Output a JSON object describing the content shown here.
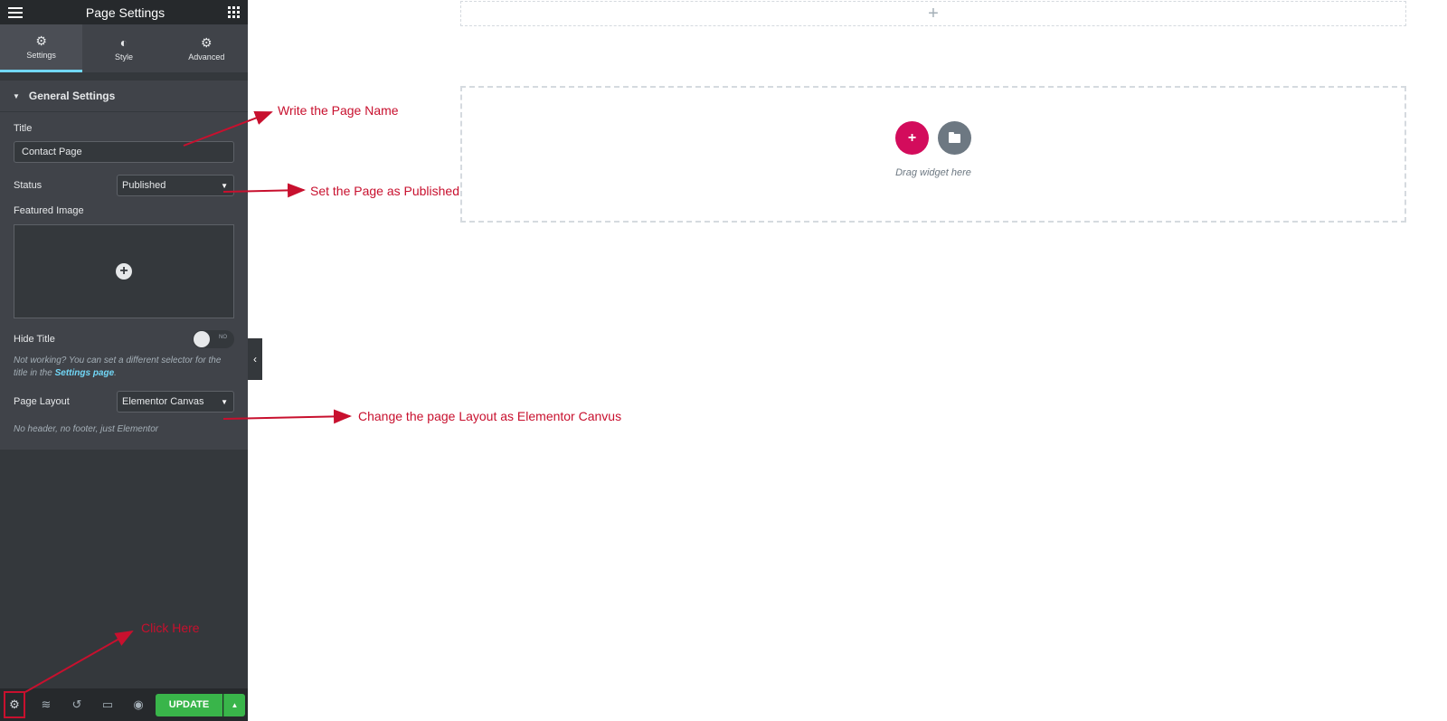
{
  "header": {
    "title": "Page Settings",
    "menu_icon": "hamburger-icon",
    "apps_icon": "grid-icon"
  },
  "tabs": [
    {
      "label": "Settings",
      "icon": "gear-icon",
      "active": true
    },
    {
      "label": "Style",
      "icon": "contrast-icon",
      "active": false
    },
    {
      "label": "Advanced",
      "icon": "gear-icon",
      "active": false
    }
  ],
  "section": {
    "title": "General Settings",
    "title_label": "Title",
    "title_value": "Contact Page",
    "status_label": "Status",
    "status_value": "Published",
    "featured_image_label": "Featured Image",
    "hide_title_label": "Hide Title",
    "hide_title_toggle": "NO",
    "note_prefix": "Not working? You can set a different selector for the title in the ",
    "note_link": "Settings page",
    "note_suffix": ".",
    "page_layout_label": "Page Layout",
    "page_layout_value": "Elementor Canvas",
    "page_layout_desc": "No header, no footer, just Elementor"
  },
  "footer": {
    "buttons": [
      "settings",
      "navigator",
      "history",
      "responsive",
      "preview"
    ],
    "update_label": "UPDATE"
  },
  "canvas": {
    "drop_text": "Drag widget here"
  },
  "annotations": {
    "page_name": "Write the Page Name",
    "published": "Set the Page as Published",
    "layout": "Change the page Layout as Elementor Canvus",
    "click": "Click Here"
  },
  "colors": {
    "accent": "#71d7f7",
    "update": "#39b54a",
    "add": "#d30c5c",
    "annotation": "#c8102e"
  }
}
